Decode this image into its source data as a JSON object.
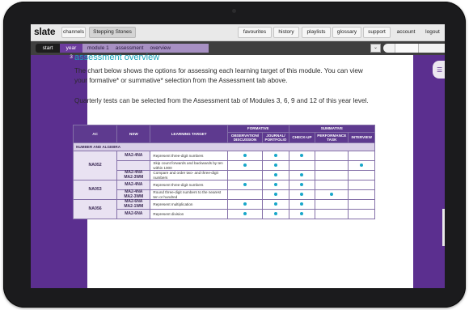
{
  "app": {
    "logo": "slate",
    "nav_tabs": [
      "channels",
      "Stepping Stones"
    ],
    "nav_links": [
      "favourites",
      "history",
      "playlists",
      "glossary",
      "support",
      "account",
      "logout"
    ]
  },
  "breadcrumb": {
    "start": "start",
    "year": "year 3",
    "module": "module 1",
    "section": "assessment",
    "page": "overview",
    "dropdown_icon": "chevron-down-icon"
  },
  "content": {
    "heading": "assessment overview",
    "paragraph1": "The chart below shows the options for assessing each learning target of this module. You can view your formative* or summative* selection from the Assessment tab above.",
    "paragraph2": "Quarterly tests can be selected from the Assessment tab of Modules 3, 6, 9 and 12 of this year level."
  },
  "table": {
    "headers": {
      "ac": "AC",
      "nsw": "NSW",
      "learning_target": "LEARNING TARGET",
      "formative": "FORMATIVE",
      "summative": "SUMMATIVE",
      "observation": "OBSERVATION/ DISCUSSION",
      "journal": "JOURNAL/ PORTFOLIO",
      "checkup": "CHECK-UP",
      "performance": "PERFORMANCE TASK",
      "interview": "INTERVIEW"
    },
    "section": "NUMBER AND ALGEBRA",
    "groups": [
      {
        "ac": "NA052",
        "rows": [
          {
            "nsw": "MA2-4NA",
            "target": "Represent three-digit numbers",
            "marks": [
              true,
              true,
              true,
              false,
              false
            ]
          },
          {
            "nsw": "",
            "target": "Skip count forwards and backwards by ten within 1000",
            "marks": [
              true,
              true,
              false,
              false,
              true
            ]
          },
          {
            "nsw": "MA2-4NA\nMA2-3WM",
            "target": "Compare and order two- and three-digit numbers",
            "marks": [
              false,
              true,
              true,
              false,
              false
            ]
          }
        ]
      },
      {
        "ac": "NA053",
        "rows": [
          {
            "nsw": "MA2-4NA",
            "target": "Represent three-digit numbers",
            "marks": [
              true,
              true,
              true,
              false,
              false
            ]
          },
          {
            "nsw": "MA2-4NA\nMA2-3WM",
            "target": "Round three-digit numbers to the nearest ten or hundred",
            "marks": [
              false,
              true,
              true,
              true,
              false
            ]
          }
        ]
      },
      {
        "ac": "NA056",
        "rows": [
          {
            "nsw": "MA2-6NA\nMA2-1WM",
            "target": "Represent multiplication",
            "marks": [
              true,
              true,
              true,
              false,
              false
            ]
          },
          {
            "nsw": "MA2-6NA",
            "target": "Represent division",
            "marks": [
              true,
              true,
              true,
              false,
              false
            ]
          }
        ]
      }
    ]
  },
  "colors": {
    "brand_purple": "#5b2f8f",
    "heading_teal": "#1aa3b8",
    "dot_blue": "#18a7c9"
  }
}
